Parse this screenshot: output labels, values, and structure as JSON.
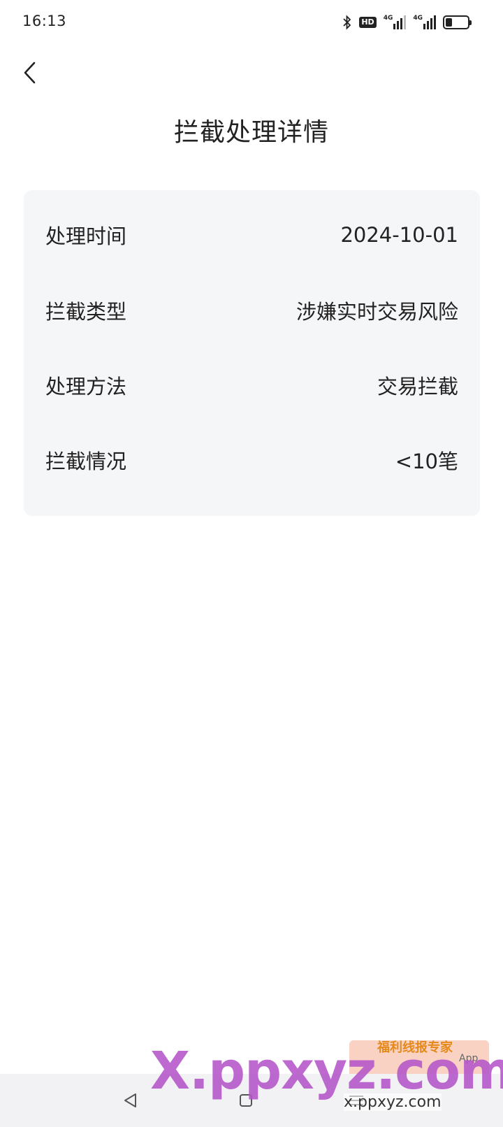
{
  "status_bar": {
    "time": "16:13",
    "icons": [
      "bluetooth-icon",
      "hd-icon",
      "signal-4g-icon",
      "signal-4g-icon",
      "battery-icon"
    ],
    "hd_label": "HD",
    "net_label_1": "4G",
    "net_label_2": "4G",
    "battery_level": 0.3
  },
  "header": {
    "back_icon": "chevron-left-icon",
    "title": "拦截处理详情"
  },
  "details": [
    {
      "label": "处理时间",
      "value": "2024-10-01"
    },
    {
      "label": "拦截类型",
      "value": "涉嫌实时交易风险"
    },
    {
      "label": "处理方法",
      "value": "交易拦截"
    },
    {
      "label": "拦截情况",
      "value": "<10笔"
    }
  ],
  "nav_bar": {
    "back": "triangle-back-icon",
    "home": "square-home-icon",
    "recents": "menu-lines-icon"
  },
  "watermark": {
    "big": "X.ppxyz.com",
    "small": "x.ppxyz.com",
    "badge_title": "福利线报专家",
    "badge_app": "App"
  },
  "colors": {
    "card_bg": "#f5f6f8",
    "text": "#222222",
    "nav_bg": "#f2f2f4",
    "watermark": "#b455c9"
  }
}
